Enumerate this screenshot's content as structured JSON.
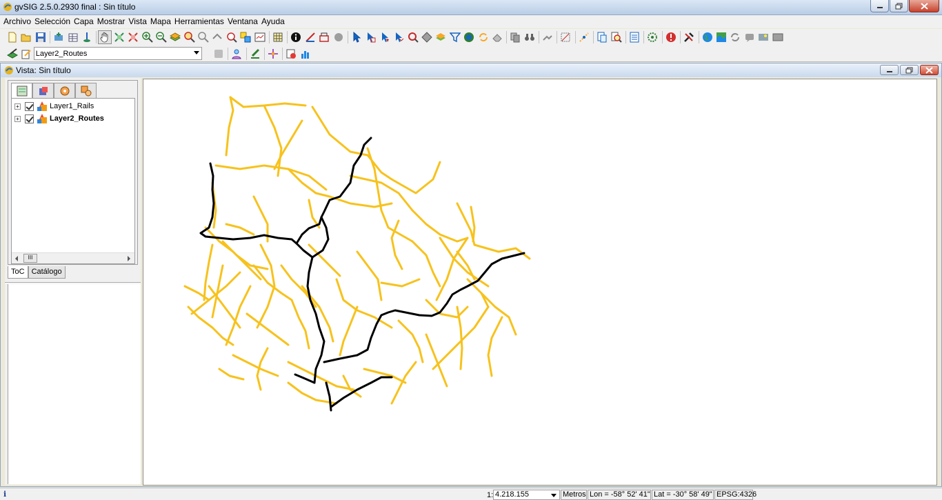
{
  "window": {
    "title": "gvSIG 2.5.0.2930 final : Sin título"
  },
  "menubar": [
    "Archivo",
    "Selección",
    "Capa",
    "Mostrar",
    "Vista",
    "Mapa",
    "Herramientas",
    "Ventana",
    "Ayuda"
  ],
  "toolbar2": {
    "layer_combo_value": "Layer2_Routes"
  },
  "view": {
    "title": "Vista: Sin título"
  },
  "toc": {
    "layers": [
      {
        "name": "Layer1_Rails",
        "checked": true,
        "bold": false
      },
      {
        "name": "Layer2_Routes",
        "checked": true,
        "bold": true
      }
    ],
    "tabs": [
      "ToC",
      "Catálogo"
    ],
    "scroll_thumb": "III"
  },
  "map": {
    "background": "#ffffff",
    "rails_color": "#f7c21c",
    "routes_color": "#000000"
  },
  "statusbar": {
    "scale_prefix": "1:",
    "scale_value": "4.218.155",
    "units": "Metros",
    "lon": "Lon = -58° 52' 41\"",
    "lat": "Lat = -30° 58' 49\"",
    "epsg": "EPSG:4326"
  }
}
